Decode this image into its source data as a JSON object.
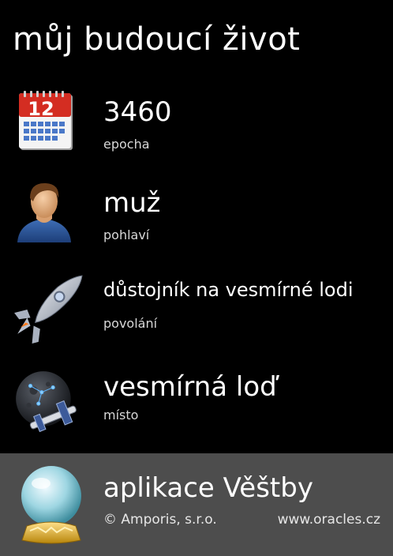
{
  "header": {
    "title": "můj budoucí život"
  },
  "items": [
    {
      "value": "3460",
      "label": "epocha",
      "icon": "calendar-icon"
    },
    {
      "value": "muž",
      "label": "pohlaví",
      "icon": "person-icon"
    },
    {
      "value": "důstojník na vesmírné lodi",
      "label": "povolání",
      "icon": "rocket-icon"
    },
    {
      "value": "vesmírná loď",
      "label": "místo",
      "icon": "spaceship-planet-icon"
    }
  ],
  "calendar": {
    "day": "12"
  },
  "footer": {
    "app_title": "aplikace Věštby",
    "copyright": "© Amporis, s.r.o.",
    "url": "www.oracles.cz",
    "icon": "crystal-ball-icon"
  },
  "colors": {
    "background": "#000000",
    "footer_background": "#4d4d4d",
    "text": "#ffffff"
  }
}
